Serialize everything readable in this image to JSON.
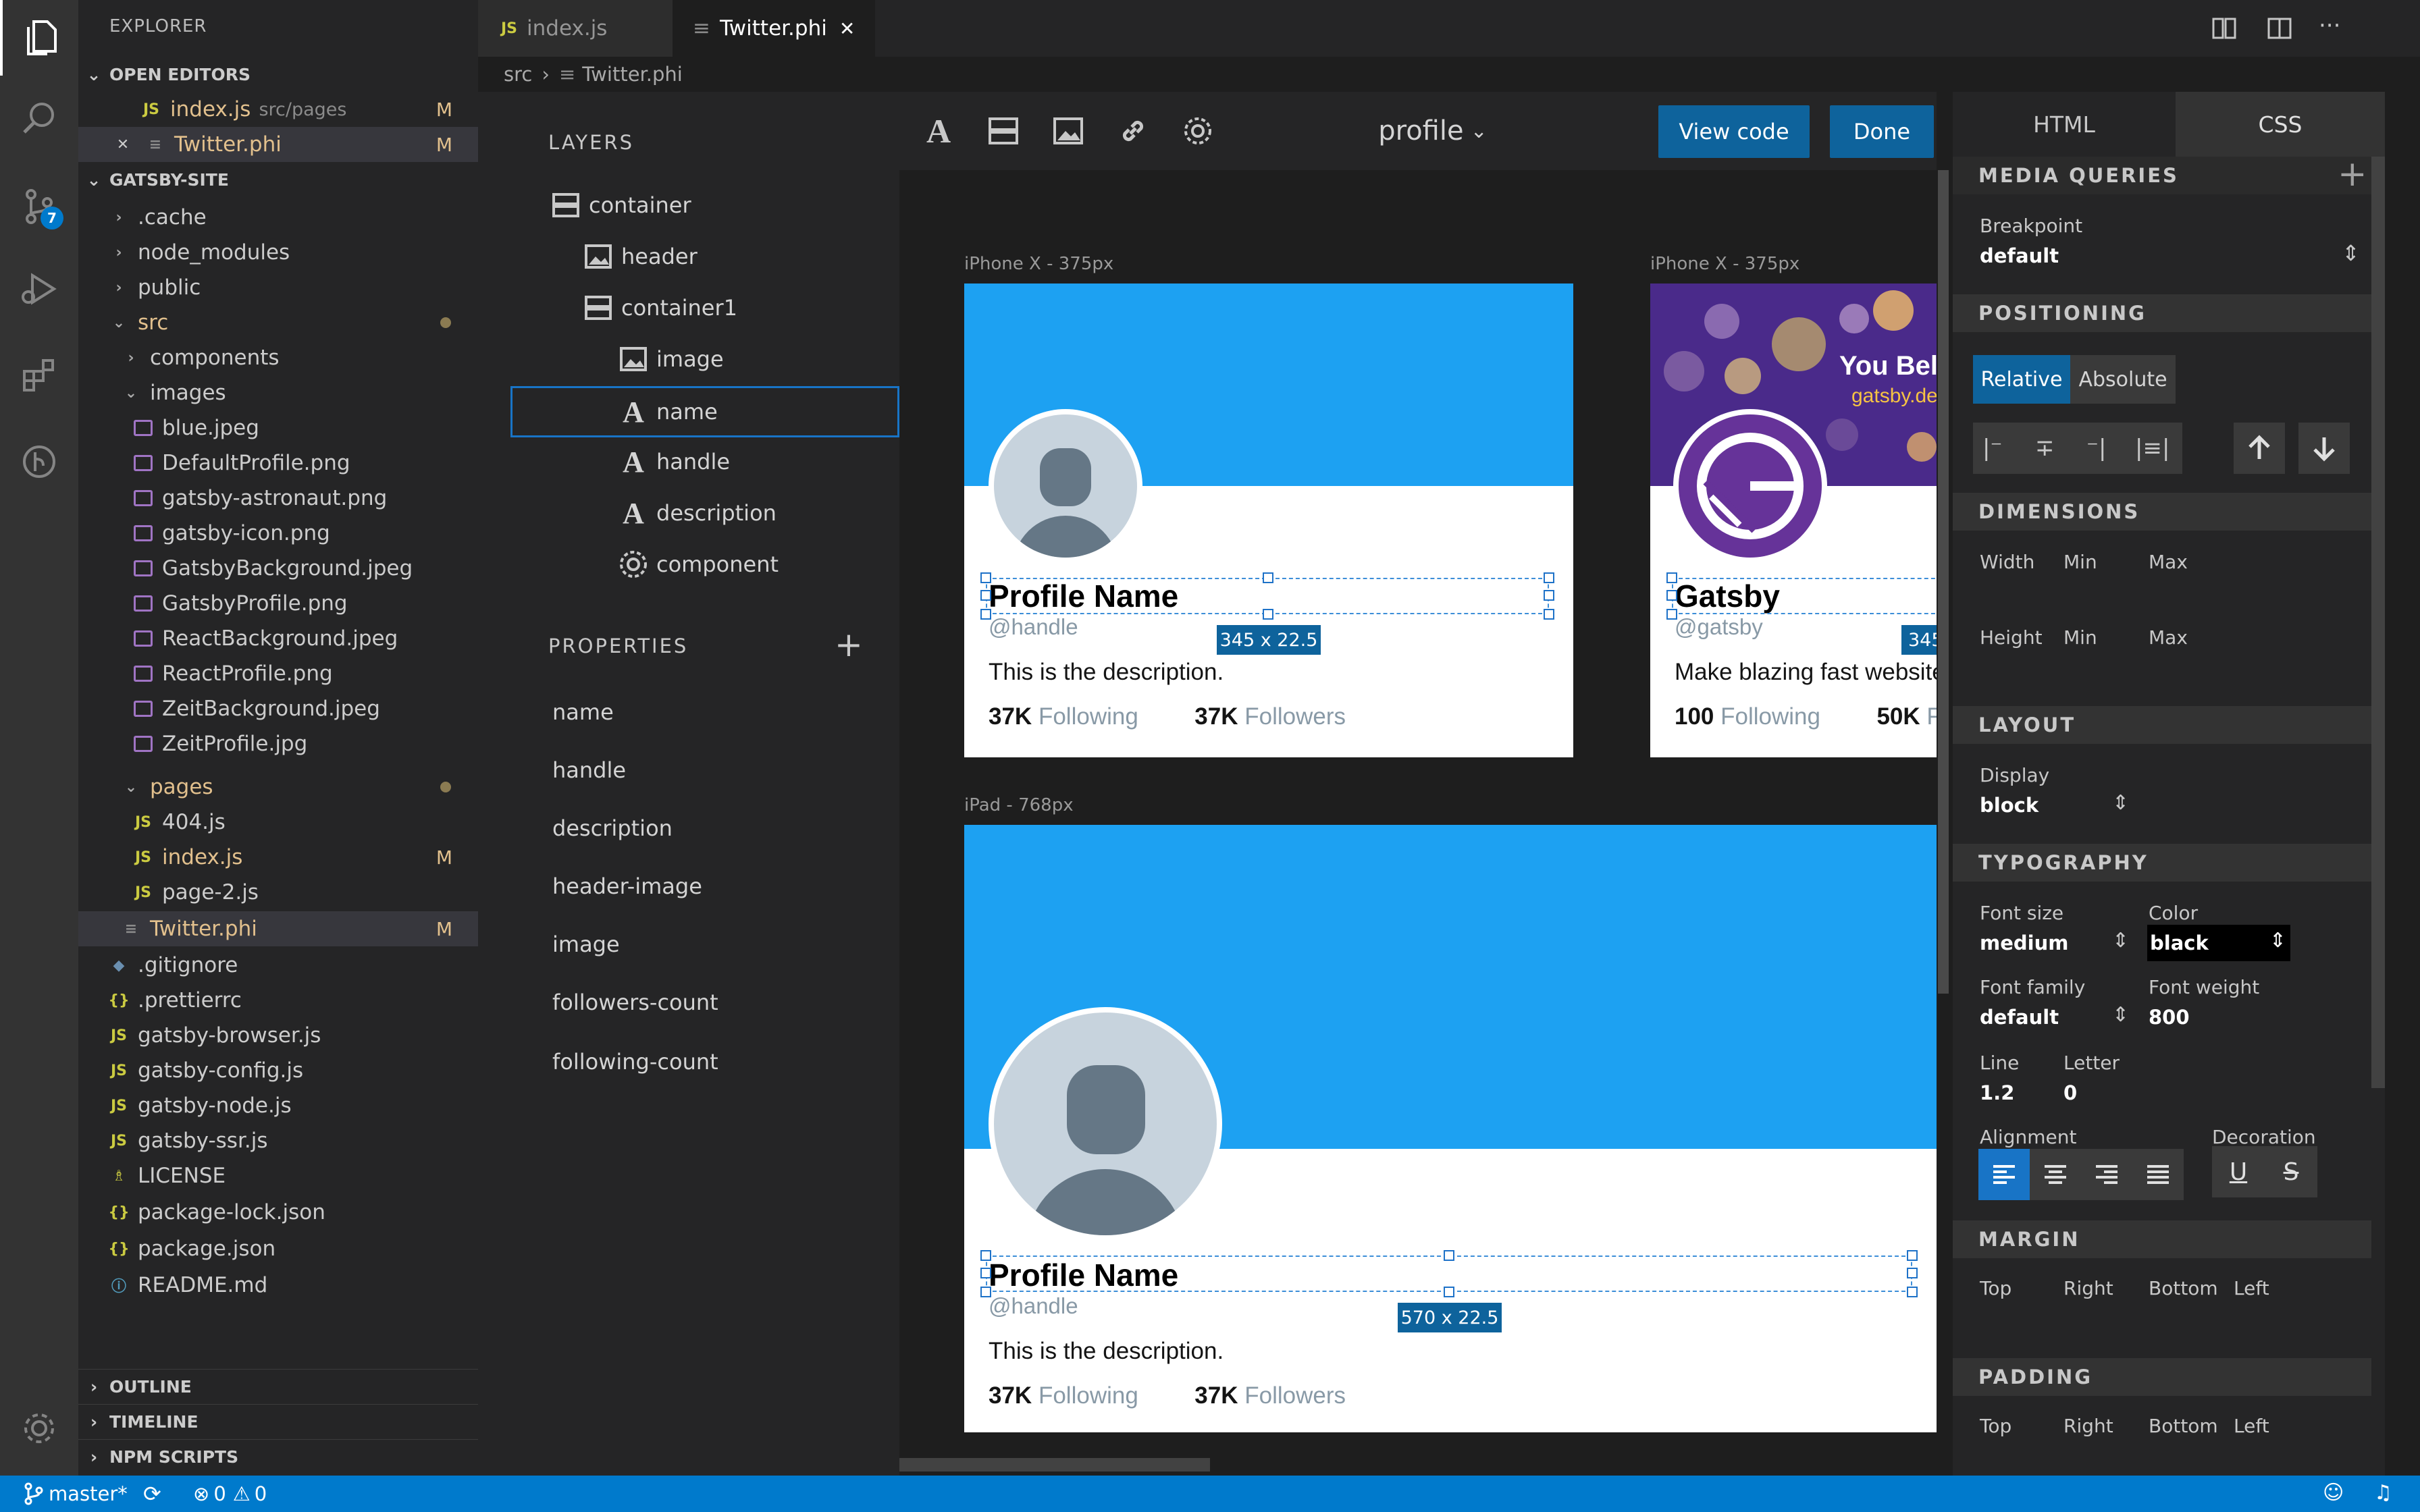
{
  "explorer": {
    "title": "EXPLORER",
    "open_editors_title": "OPEN EDITORS",
    "open_editors": [
      {
        "name": "index.js",
        "path": "src/pages",
        "status": "M"
      },
      {
        "name": "Twitter.phi",
        "status": "M"
      }
    ],
    "project_title": "GATSBY-SITE",
    "tree": [
      {
        "label": ".cache"
      },
      {
        "label": "node_modules"
      },
      {
        "label": "public"
      },
      {
        "label": "src"
      },
      {
        "label": "components"
      },
      {
        "label": "images"
      },
      {
        "label": "blue.jpeg"
      },
      {
        "label": "DefaultProfile.png"
      },
      {
        "label": "gatsby-astronaut.png"
      },
      {
        "label": "gatsby-icon.png"
      },
      {
        "label": "GatsbyBackground.jpeg"
      },
      {
        "label": "GatsbyProfile.png"
      },
      {
        "label": "ReactBackground.jpeg"
      },
      {
        "label": "ReactProfile.png"
      },
      {
        "label": "ZeitBackground.jpeg"
      },
      {
        "label": "ZeitProfile.jpg"
      },
      {
        "label": "pages"
      },
      {
        "label": "404.js"
      },
      {
        "label": "index.js",
        "status": "M"
      },
      {
        "label": "page-2.js"
      },
      {
        "label": "Twitter.phi",
        "status": "M"
      },
      {
        "label": ".gitignore"
      },
      {
        "label": ".prettierrc"
      },
      {
        "label": "gatsby-browser.js"
      },
      {
        "label": "gatsby-config.js"
      },
      {
        "label": "gatsby-node.js"
      },
      {
        "label": "gatsby-ssr.js"
      },
      {
        "label": "LICENSE"
      },
      {
        "label": "package-lock.json"
      },
      {
        "label": "package.json"
      },
      {
        "label": "README.md"
      }
    ],
    "outline": "OUTLINE",
    "timeline": "TIMELINE",
    "npm_scripts": "NPM SCRIPTS"
  },
  "activity": {
    "scm_badge": "7"
  },
  "tabs": [
    {
      "label": "index.js",
      "icon": "JS"
    },
    {
      "label": "Twitter.phi"
    }
  ],
  "breadcrumb": {
    "folder": "src",
    "file": "Twitter.phi"
  },
  "layers": {
    "title": "LAYERS",
    "items": [
      {
        "label": "container",
        "icon": "container-icon"
      },
      {
        "label": "header",
        "icon": "image-icon"
      },
      {
        "label": "container1",
        "icon": "container-icon"
      },
      {
        "label": "image",
        "icon": "image-icon"
      },
      {
        "label": "name",
        "icon": "text-icon"
      },
      {
        "label": "handle",
        "icon": "text-icon"
      },
      {
        "label": "description",
        "icon": "text-icon"
      },
      {
        "label": "component",
        "icon": "component-icon"
      }
    ],
    "properties_title": "PROPERTIES",
    "properties": [
      "name",
      "handle",
      "description",
      "header-image",
      "image",
      "followers-count",
      "following-count"
    ]
  },
  "canvas": {
    "component": "profile",
    "view_code": "View code",
    "done": "Done",
    "frames": [
      {
        "label": "iPhone X - 375px",
        "name": "Profile Name",
        "handle": "@handle",
        "description": "This is the description.",
        "following_count": "37K",
        "following_label": "Following",
        "followers_count": "37K",
        "followers_label": "Followers",
        "dim": "345 x 22.5"
      },
      {
        "label": "iPhone X - 375px",
        "name": "Gatsby",
        "handle": "@gatsby",
        "description": "Make blazing fast website",
        "following_count": "100",
        "following_label": "Following",
        "followers_count": "50K",
        "followers_label": "F",
        "dim": "345",
        "banner_text": "You Bel",
        "banner_sub": "gatsby.de"
      },
      {
        "label": "iPad - 768px",
        "name": "Profile Name",
        "handle": "@handle",
        "description": "This is the description.",
        "following_count": "37K",
        "following_label": "Following",
        "followers_count": "37K",
        "followers_label": "Followers",
        "dim": "570 x 22.5"
      }
    ]
  },
  "css_panel": {
    "tab_html": "HTML",
    "tab_css": "CSS",
    "media_queries": "MEDIA QUERIES",
    "breakpoint_label": "Breakpoint",
    "breakpoint_value": "default",
    "positioning": "POSITIONING",
    "pos_relative": "Relative",
    "pos_absolute": "Absolute",
    "dimensions": "DIMENSIONS",
    "width": "Width",
    "height": "Height",
    "min": "Min",
    "max": "Max",
    "layout": "LAYOUT",
    "display_label": "Display",
    "display_value": "block",
    "typography": "TYPOGRAPHY",
    "font_size_label": "Font size",
    "font_size_value": "medium",
    "color_label": "Color",
    "color_value": "black",
    "font_family_label": "Font family",
    "font_family_value": "default",
    "font_weight_label": "Font weight",
    "font_weight_value": "800",
    "line_label": "Line",
    "line_value": "1.2",
    "letter_label": "Letter",
    "letter_value": "0",
    "alignment_label": "Alignment",
    "decoration_label": "Decoration",
    "margin": "MARGIN",
    "padding": "PADDING",
    "top": "Top",
    "right": "Right",
    "bottom": "Bottom",
    "left": "Left"
  },
  "status": {
    "branch": "master*",
    "errors": "0",
    "warnings": "0"
  },
  "colors": {
    "accent": "#007acc",
    "twitter_blue": "#1da1f2",
    "gatsby_purple": "#663399",
    "modified": "#e2c08d"
  }
}
